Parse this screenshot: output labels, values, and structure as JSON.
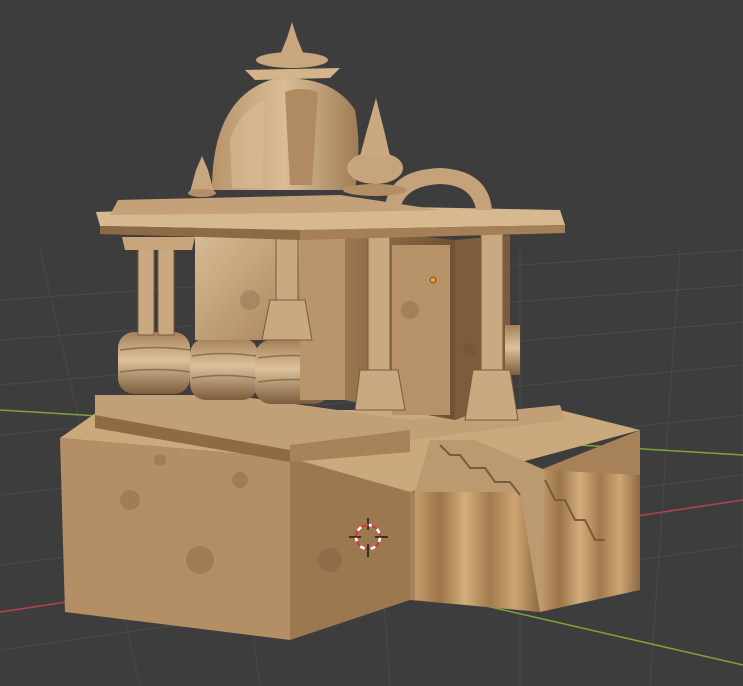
{
  "viewport": {
    "background": "#3d3d3d",
    "grid_color": "#4a4a4a",
    "axis_x_color": "#b5424e",
    "axis_y_color": "#7ea33a"
  },
  "scene": {
    "object": "stone-temple-model",
    "material_colors": {
      "light": "#d2b38b",
      "mid": "#b48f65",
      "dark": "#7a5a3a",
      "shadow": "#5a3f26"
    },
    "origin_dot_color": "#f29a2e",
    "cursor_icon": "3d-cursor-icon"
  }
}
